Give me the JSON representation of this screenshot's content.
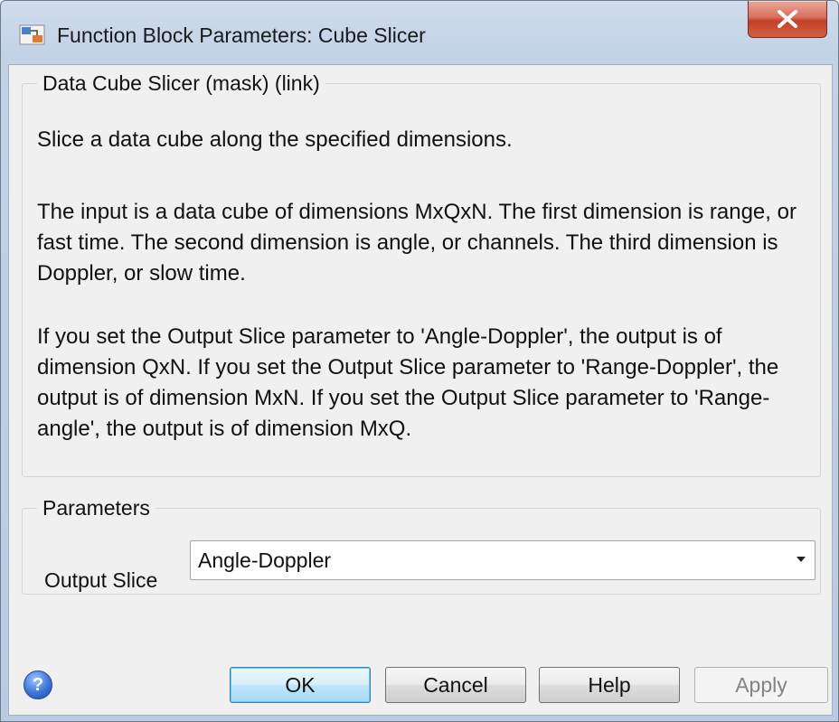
{
  "window": {
    "title": "Function Block Parameters: Cube Slicer",
    "close_label": "X"
  },
  "description": {
    "heading": "Data Cube Slicer (mask) (link)",
    "paragraph1": "Slice a data cube along the specified dimensions.",
    "paragraph2": "The input is a data cube of dimensions MxQxN. The first dimension is range, or fast time. The second dimension is angle, or channels. The third dimension is Doppler, or slow time.",
    "paragraph3": "If you set the Output Slice parameter to 'Angle-Doppler', the output is of dimension QxN. If you set the Output Slice parameter to 'Range-Doppler', the output is of dimension MxN. If you set the Output Slice parameter to 'Range-angle', the output is of dimension MxQ."
  },
  "parameters": {
    "heading": "Parameters",
    "output_slice_label": "Output Slice",
    "output_slice_value": "Angle-Doppler"
  },
  "buttons": {
    "help_icon": "?",
    "ok": "OK",
    "cancel": "Cancel",
    "help": "Help",
    "apply": "Apply"
  },
  "colors": {
    "default_button_border": "#3c7fb1",
    "close_button": "#c4402a",
    "disabled_text": "#838383"
  },
  "icons": {
    "app": "simulink-block-icon",
    "close": "close-icon",
    "help": "help-question-icon",
    "dropdown": "chevron-down-icon"
  }
}
